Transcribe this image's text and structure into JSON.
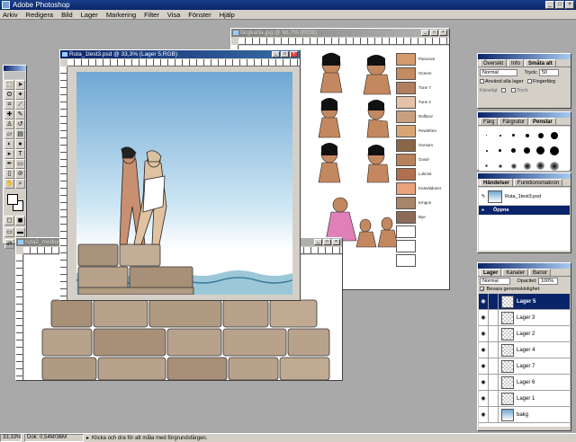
{
  "app": {
    "title": "Adobe Photoshop"
  },
  "menu": [
    "Arkiv",
    "Redigera",
    "Bild",
    "Lager",
    "Markering",
    "Filter",
    "Visa",
    "Fönster",
    "Hjälp"
  ],
  "docs": {
    "fargkarta": {
      "title": "färgkarta.jpg @ 66,7% (RGB)"
    },
    "ruta1": {
      "title": "Ruta_1test3.psd @ 33,3% (Lager 5,RGB)"
    },
    "ruta2": {
      "title": "ruta2_medium"
    }
  },
  "swatches": [
    {
      "label": "Panorum",
      "color": "#d49a6a"
    },
    {
      "label": "Oceem",
      "color": "#c48a60"
    },
    {
      "label": "Tune 7",
      "color": "#b27e5e"
    },
    {
      "label": "Tune 2",
      "color": "#e6c2a8"
    },
    {
      "label": "Rofläror",
      "color": "#c8a080"
    },
    {
      "label": "Pewlöföre",
      "color": "#d8a674"
    },
    {
      "label": "Oorsam",
      "color": "#8a6646"
    },
    {
      "label": "Oosié",
      "color": "#b8825a"
    },
    {
      "label": "Lukmst",
      "color": "#b07050"
    },
    {
      "label": "Knäväldoner",
      "color": "#e8a27c"
    },
    {
      "label": "Kmgon",
      "color": "#a88468"
    },
    {
      "label": "Bye",
      "color": "#8c6a58"
    },
    {
      "label": "",
      "color": "#ffffff"
    },
    {
      "label": "",
      "color": "#ffffff"
    },
    {
      "label": "",
      "color": "#ffffff"
    }
  ],
  "swatch_panel": {
    "tabs": [
      "Översikt",
      "Info",
      "Småta alt"
    ],
    "mode": "Normal",
    "opacity_label": "Tryck:",
    "opacity": "50",
    "check1": "Använd alla lager",
    "check2": "Fingerfärg",
    "check3": "Känsligt",
    "check4": "Tryck"
  },
  "brushes": {
    "tabs": [
      "Färg",
      "Färgrutor",
      "Penslar"
    ],
    "sizes": [
      "",
      "",
      "",
      "",
      "",
      "",
      "",
      "",
      "",
      "",
      "",
      "",
      "",
      "",
      "",
      "",
      "",
      "",
      "",
      "",
      "45",
      "65",
      "100",
      "200",
      "300",
      "35",
      "45",
      "65",
      "100",
      "200"
    ]
  },
  "history": {
    "tabs": [
      "Händelser",
      "Funktionsmakron"
    ],
    "items": [
      "Ruta_1test3.psd",
      "Öppna"
    ]
  },
  "layers": {
    "tabs": [
      "Lager",
      "Kanaler",
      "Banor"
    ],
    "mode": "Normal",
    "opacity_label": "Opacitet:",
    "opacity": "100%",
    "preserve": "Bevara genomskinlighet",
    "items": [
      "Lager 5",
      "Lager 3",
      "Lager 2",
      "Lager 4",
      "Lager 7",
      "Lager 6",
      "Lager 1",
      "bakg"
    ]
  },
  "status": {
    "zoom": "33,33%",
    "doc": "Dok: 0,54M/36M",
    "hint": "Klicka och dra för att måla med förgrundsfärgen."
  }
}
